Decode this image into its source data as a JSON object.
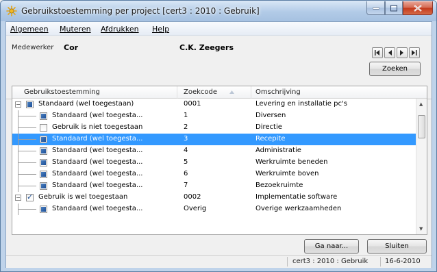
{
  "window": {
    "title": "Gebruikstoestemming per project  [cert3 : 2010 : Gebruik]"
  },
  "menu": [
    {
      "label": "Algemeen"
    },
    {
      "label": "Muteren"
    },
    {
      "label": "Afdrukken"
    },
    {
      "label": "Help"
    }
  ],
  "header": {
    "employee_label": "Medewerker",
    "employee_code": "Cor",
    "employee_name": "C.K. Zeegers",
    "search_button": "Zoeken"
  },
  "grid": {
    "columns": [
      "Gebruikstoestemming",
      "Zoekcode",
      "Omschrijving"
    ],
    "sort_column": "Zoekcode",
    "rows": [
      {
        "level": 0,
        "expander": "−",
        "check": "filled",
        "toestemming": "Standaard (wel toegestaan)",
        "zoekcode": "0001",
        "omschrijving": "Levering en installatie pc's"
      },
      {
        "level": 1,
        "check": "filled",
        "toestemming": "Standaard (wel toegesta...",
        "zoekcode": "1",
        "omschrijving": "Diversen"
      },
      {
        "level": 1,
        "check": "empty",
        "toestemming": "Gebruik is niet toegestaan",
        "zoekcode": "2",
        "omschrijving": "Directie"
      },
      {
        "level": 1,
        "check": "filled",
        "toestemming": "Standaard (wel toegesta...",
        "zoekcode": "3",
        "omschrijving": "Recepite",
        "selected": true
      },
      {
        "level": 1,
        "check": "filled",
        "toestemming": "Standaard (wel toegesta...",
        "zoekcode": "4",
        "omschrijving": "Administratie"
      },
      {
        "level": 1,
        "check": "filled",
        "toestemming": "Standaard (wel toegesta...",
        "zoekcode": "5",
        "omschrijving": "Werkruimte beneden"
      },
      {
        "level": 1,
        "check": "filled",
        "toestemming": "Standaard (wel toegesta...",
        "zoekcode": "6",
        "omschrijving": "Werkruimte boven"
      },
      {
        "level": 1,
        "check": "filled",
        "toestemming": "Standaard (wel toegesta...",
        "zoekcode": "7",
        "omschrijving": "Bezoekruimte"
      },
      {
        "level": 0,
        "expander": "−",
        "check": "checked",
        "toestemming": "Gebruik is wel toegestaan",
        "zoekcode": "0002",
        "omschrijving": "Implementatie software"
      },
      {
        "level": 1,
        "check": "filled",
        "toestemming": "Standaard (wel toegesta...",
        "zoekcode": "Overig",
        "omschrijving": "Overige werkzaamheden"
      }
    ]
  },
  "buttons": {
    "goto": "Ga naar...",
    "close": "Sluiten"
  },
  "status": {
    "context": "cert3 : 2010 : Gebruik",
    "date": "16-6-2010"
  },
  "colors": {
    "selection": "#3399ff",
    "title_gradient": "#b2cbe7"
  }
}
